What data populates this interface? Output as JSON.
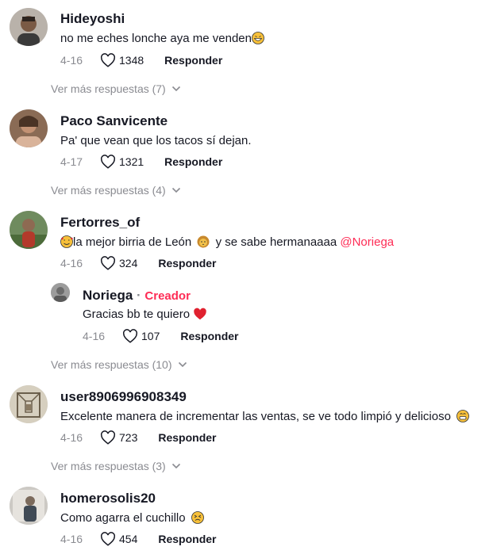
{
  "comments": [
    {
      "username": "Hideyoshi",
      "text_before": "no me eches lonche aya me venden",
      "emoji_end": "grinning-face-icon",
      "date": "4-16",
      "likes": "1348",
      "reply_label": "Responder",
      "more_replies": "Ver más respuestas (7)"
    },
    {
      "username": "Paco Sanvicente",
      "text": "Pa' que vean que los tacos sí dejan.",
      "date": "4-17",
      "likes": "1321",
      "reply_label": "Responder",
      "more_replies": "Ver más respuestas (4)"
    },
    {
      "username": "Fertorres_of",
      "text_part1": "la mejor birria de León",
      "text_part2": "y se sabe hermanaaaa",
      "mention": "@Noriega",
      "date": "4-16",
      "likes": "324",
      "reply_label": "Responder",
      "reply": {
        "username": "Noriega",
        "separator": " · ",
        "creator_label": "Creador",
        "text": "Gracias bb te quiero",
        "date": "4-16",
        "likes": "107",
        "reply_label": "Responder"
      },
      "more_replies": "Ver más respuestas (10)"
    },
    {
      "username": "user8906996908349",
      "text": "Excelente manera de incrementar las ventas, se ve todo limpió y delicioso",
      "date": "4-16",
      "likes": "723",
      "reply_label": "Responder",
      "more_replies": "Ver más respuestas (3)"
    },
    {
      "username": "homerosolis20",
      "text": "Como agarra el cuchillo",
      "date": "4-16",
      "likes": "454",
      "reply_label": "Responder"
    }
  ],
  "colors": {
    "accent": "#fe2c55",
    "text": "#161823",
    "muted": "#8a8b91",
    "heart_red": "#e0212f"
  }
}
